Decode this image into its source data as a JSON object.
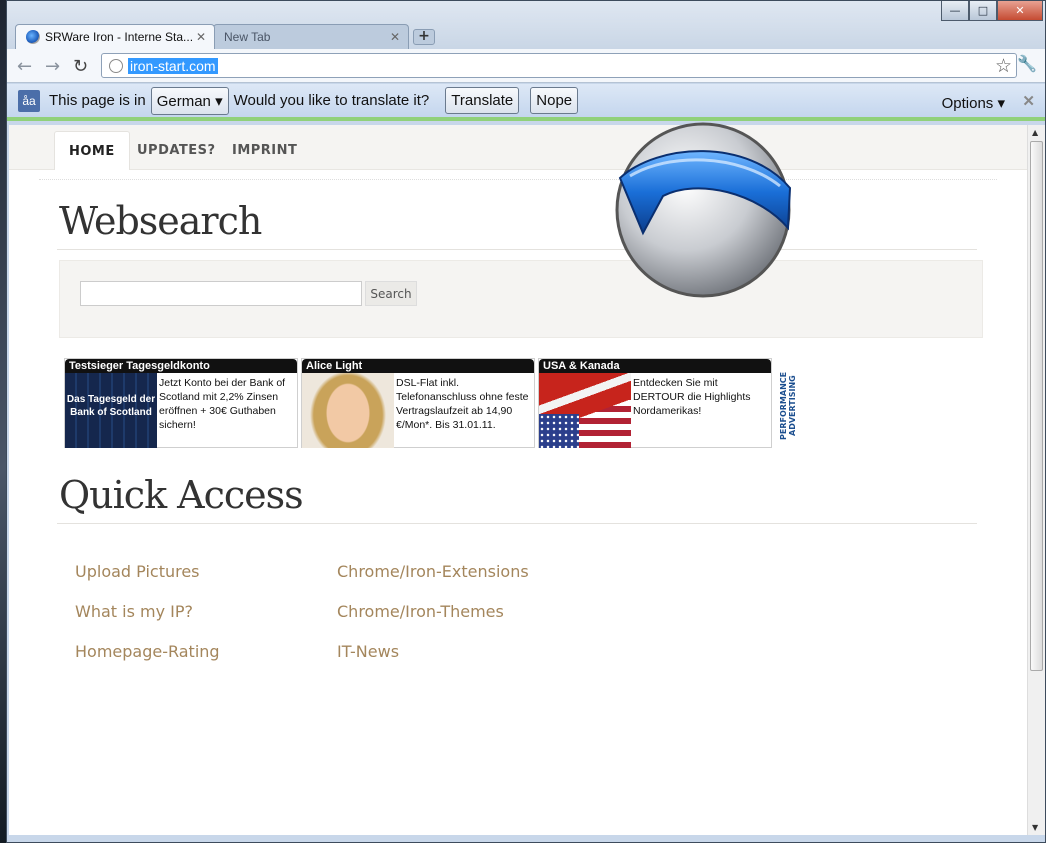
{
  "browser": {
    "tabs": [
      {
        "title": "SRWare Iron - Interne Sta...",
        "active": true
      },
      {
        "title": "New Tab",
        "active": false
      }
    ],
    "new_tab_symbol": "+",
    "address": "iron-start.com",
    "window_controls": {
      "minimize": "—",
      "maximize": "□",
      "close": "✕"
    }
  },
  "translate_bar": {
    "prefix": "This page is in",
    "language": "German",
    "question": "Would you like to translate it?",
    "translate_label": "Translate",
    "nope_label": "Nope",
    "options_label": "Options"
  },
  "site_nav": {
    "items": [
      {
        "label": "HOME",
        "active": true
      },
      {
        "label": "UPDATES?",
        "active": false
      },
      {
        "label": "IMPRINT",
        "active": false
      }
    ]
  },
  "websearch": {
    "heading": "Websearch",
    "button_label": "Search",
    "input_value": ""
  },
  "ads": [
    {
      "header": "Testsieger Tagesgeldkonto",
      "image_text": "Das Tagesgeld der Bank of Scotland",
      "text": "Jetzt Konto bei der Bank of Scotland mit 2,2% Zinsen eröffnen + 30€ Guthaben sichern!"
    },
    {
      "header": "Alice Light",
      "image_text": "",
      "text": "DSL-Flat inkl. Telefonanschluss ohne feste Vertragslaufzeit ab 14,90 €/Mon*. Bis 31.01.11."
    },
    {
      "header": "USA & Kanada",
      "image_text": "",
      "text": "Entdecken Sie mit DERTOUR die Highlights Nordamerikas!"
    }
  ],
  "ad_badge": "PERFORMANCE ADVERTISING",
  "quick_access": {
    "heading": "Quick Access",
    "links": [
      "Upload Pictures",
      "What is my IP?",
      "Homepage-Rating",
      "Chrome/Iron-Extensions",
      "Chrome/Iron-Themes",
      "IT-News"
    ]
  },
  "colors": {
    "link": "#a4865c",
    "url_highlight": "#3399ff",
    "infobar_accent": "#90d17a",
    "logo_blue": "#1a6fd8"
  },
  "icons": [
    "back-icon",
    "forward-icon",
    "reload-icon",
    "globe-icon",
    "star-icon",
    "wrench-icon",
    "translate-icon",
    "close-icon",
    "iron-logo"
  ]
}
